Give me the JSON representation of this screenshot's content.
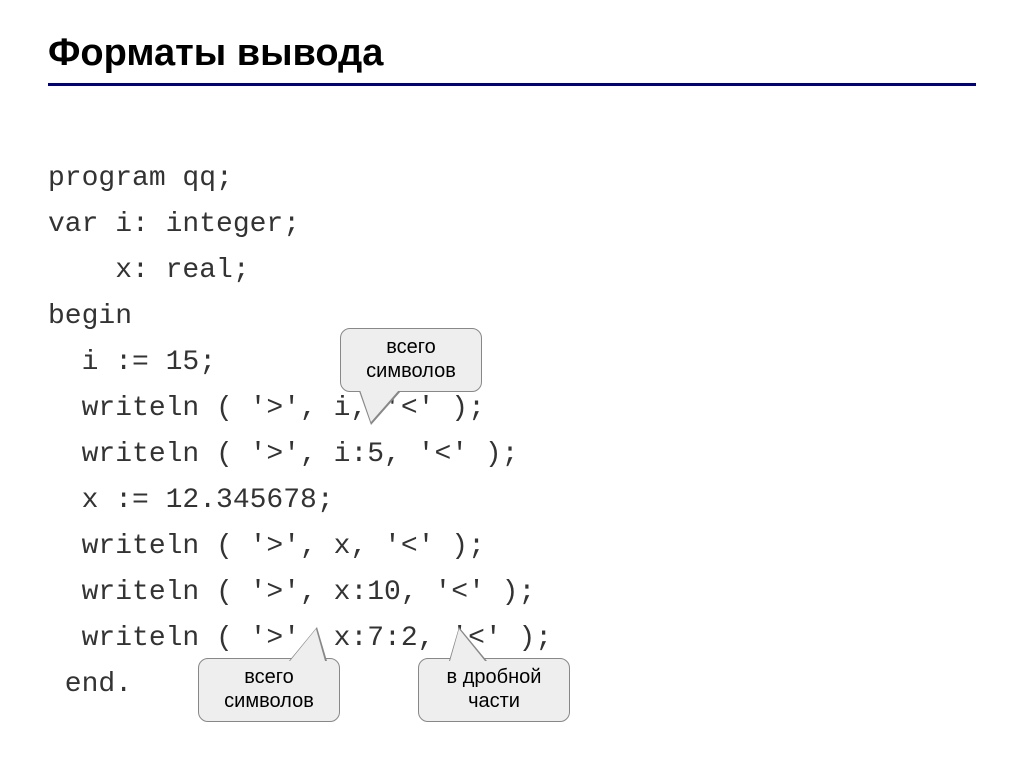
{
  "title": "Форматы вывода",
  "code": {
    "l1": "program qq;",
    "l2": "var i: integer;",
    "l3": "    x: real;",
    "l4": "begin",
    "l5": "  i := 15;",
    "l6": "  writeln ( '>', i, '<' );",
    "l7": "  writeln ( '>', i:5, '<' );",
    "l8": "  x := 12.345678;",
    "l9": "  writeln ( '>', x, '<' );",
    "l10": "  writeln ( '>', x:10, '<' );",
    "l11": "  writeln ( '>', x:7:2, '<' );",
    "l12": " end."
  },
  "callouts": {
    "c1_l1": "всего",
    "c1_l2": "символов",
    "c2_l1": "всего",
    "c2_l2": "символов",
    "c3_l1": "в дробной",
    "c3_l2": "части"
  }
}
